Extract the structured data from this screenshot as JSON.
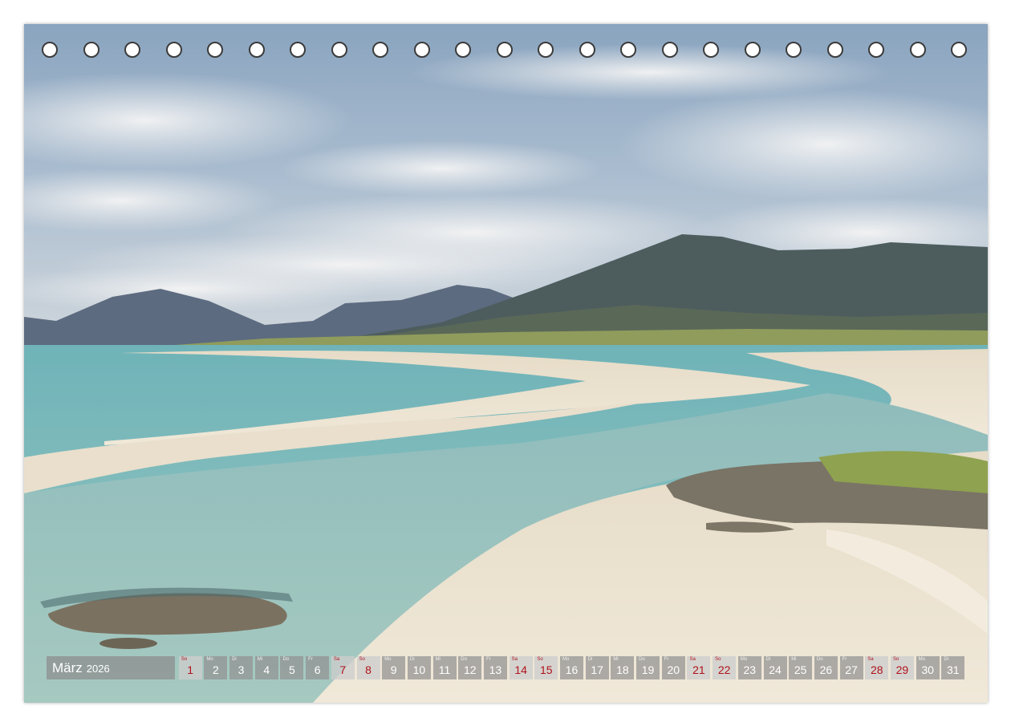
{
  "calendar": {
    "month": "März",
    "year": "2026",
    "colors": {
      "weekday_box": "#919191",
      "weekend_box": "#cdcdcd",
      "weekend_text": "#b0121b",
      "text": "#ffffff"
    },
    "days": [
      {
        "wd": "So",
        "n": "1",
        "weekend": true
      },
      {
        "wd": "Mo",
        "n": "2",
        "weekend": false
      },
      {
        "wd": "Di",
        "n": "3",
        "weekend": false
      },
      {
        "wd": "Mi",
        "n": "4",
        "weekend": false
      },
      {
        "wd": "Do",
        "n": "5",
        "weekend": false
      },
      {
        "wd": "Fr",
        "n": "6",
        "weekend": false
      },
      {
        "wd": "Sa",
        "n": "7",
        "weekend": true
      },
      {
        "wd": "So",
        "n": "8",
        "weekend": true
      },
      {
        "wd": "Mo",
        "n": "9",
        "weekend": false
      },
      {
        "wd": "Di",
        "n": "10",
        "weekend": false
      },
      {
        "wd": "Mi",
        "n": "11",
        "weekend": false
      },
      {
        "wd": "Do",
        "n": "12",
        "weekend": false
      },
      {
        "wd": "Fr",
        "n": "13",
        "weekend": false
      },
      {
        "wd": "Sa",
        "n": "14",
        "weekend": true
      },
      {
        "wd": "So",
        "n": "15",
        "weekend": true
      },
      {
        "wd": "Mo",
        "n": "16",
        "weekend": false
      },
      {
        "wd": "Di",
        "n": "17",
        "weekend": false
      },
      {
        "wd": "Mi",
        "n": "18",
        "weekend": false
      },
      {
        "wd": "Do",
        "n": "19",
        "weekend": false
      },
      {
        "wd": "Fr",
        "n": "20",
        "weekend": false
      },
      {
        "wd": "Sa",
        "n": "21",
        "weekend": true
      },
      {
        "wd": "So",
        "n": "22",
        "weekend": true
      },
      {
        "wd": "Mo",
        "n": "23",
        "weekend": false
      },
      {
        "wd": "Di",
        "n": "24",
        "weekend": false
      },
      {
        "wd": "Mi",
        "n": "25",
        "weekend": false
      },
      {
        "wd": "Do",
        "n": "26",
        "weekend": false
      },
      {
        "wd": "Fr",
        "n": "27",
        "weekend": false
      },
      {
        "wd": "Sa",
        "n": "28",
        "weekend": true
      },
      {
        "wd": "So",
        "n": "29",
        "weekend": true
      },
      {
        "wd": "Mo",
        "n": "30",
        "weekend": false
      },
      {
        "wd": "Di",
        "n": "31",
        "weekend": false
      }
    ]
  },
  "binding": {
    "hole_count": 23,
    "hole_style": "white-circle-dark-outline"
  },
  "photo": {
    "subject": "landscape-beach-mountains",
    "palette": {
      "sky_top": "#8fa9c4",
      "cloud": "#e4e6e8",
      "mountain_far": "#56647a",
      "mountain_near": "#4a5a58",
      "grass": "#8f9c5c",
      "sand": "#ece3d2",
      "water_turquoise": "#8fc2c4",
      "water_deep": "#6ea7ab",
      "rock": "#7d7566"
    }
  }
}
